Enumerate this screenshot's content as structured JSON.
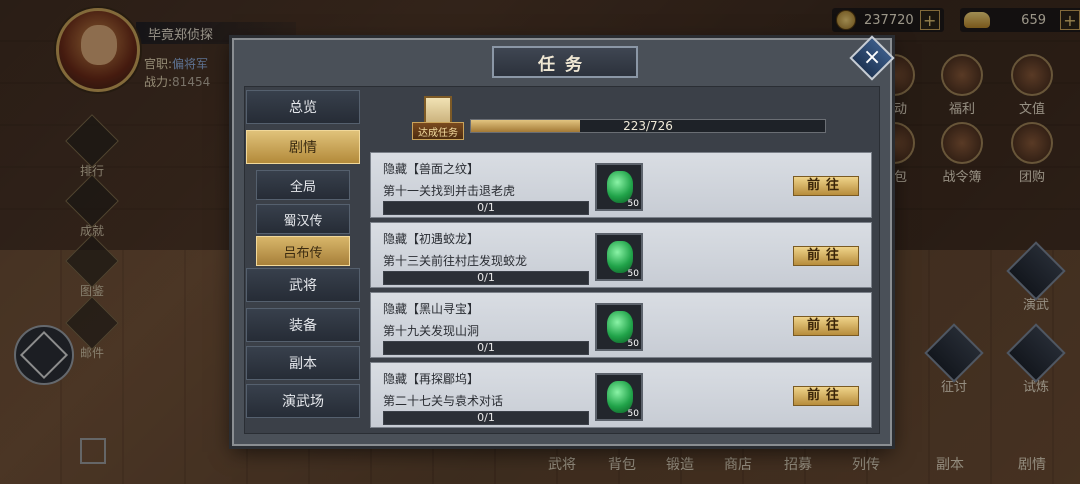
{
  "player": {
    "name": "毕竟郑侦探",
    "rank_label": "官职:",
    "rank_value": "偏将军",
    "power_label": "战力:",
    "power_value": "81454"
  },
  "currency": {
    "coins": "237720",
    "ingots": "659",
    "plus": "+"
  },
  "side_menu": [
    {
      "label": "排行",
      "icon": "ranking-icon"
    },
    {
      "label": "成就",
      "icon": "achievement-icon"
    },
    {
      "label": "图鉴",
      "icon": "codex-icon"
    },
    {
      "label": "邮件",
      "icon": "mail-icon"
    }
  ],
  "right_icons": {
    "top": [
      {
        "label": "活动",
        "icon": "event-icon"
      },
      {
        "label": "福利",
        "icon": "welfare-icon"
      },
      {
        "label": "文值",
        "icon": "gold-icon"
      },
      {
        "label": "礼包",
        "icon": "gift-pack-icon"
      },
      {
        "label": "战令簿",
        "icon": "battle-pass-icon"
      },
      {
        "label": "团购",
        "icon": "group-buy-icon"
      }
    ],
    "side": [
      {
        "label": "演武",
        "icon": "drill-icon"
      },
      {
        "label": "征讨",
        "icon": "campaign-icon"
      },
      {
        "label": "试炼",
        "icon": "trial-icon"
      }
    ]
  },
  "bottom_bar": [
    "武将",
    "背包",
    "锻造",
    "商店",
    "招募",
    "列传",
    "副本",
    "剧情"
  ],
  "panel": {
    "title": "任务",
    "close": "×"
  },
  "tabs": [
    {
      "label": "总览",
      "selected": false,
      "sub": false
    },
    {
      "label": "剧情",
      "selected": true,
      "sub": false
    },
    {
      "label": "全局",
      "selected": false,
      "sub": true
    },
    {
      "label": "蜀汉传",
      "selected": false,
      "sub": true
    },
    {
      "label": "吕布传",
      "selected": true,
      "sub": true
    },
    {
      "label": "武将",
      "selected": false,
      "sub": false
    },
    {
      "label": "装备",
      "selected": false,
      "sub": false
    },
    {
      "label": "副本",
      "selected": false,
      "sub": false
    },
    {
      "label": "演武场",
      "selected": false,
      "sub": false
    }
  ],
  "progress": {
    "badge_label": "达成任务",
    "current": 223,
    "total": 726,
    "text": "223/726"
  },
  "quests": [
    {
      "title": "隐藏【兽面之纹】",
      "desc": "第十一关找到并击退老虎",
      "progress": "0/1",
      "reward_count": "50",
      "button": "前往"
    },
    {
      "title": "隐藏【初遇蛟龙】",
      "desc": "第十三关前往村庄发现蛟龙",
      "progress": "0/1",
      "reward_count": "50",
      "button": "前往"
    },
    {
      "title": "隐藏【黑山寻宝】",
      "desc": "第十九关发现山洞",
      "progress": "0/1",
      "reward_count": "50",
      "button": "前往"
    },
    {
      "title": "隐藏【再探郿坞】",
      "desc": "第二十七关与袁术对话",
      "progress": "0/1",
      "reward_count": "50",
      "button": "前往"
    }
  ]
}
